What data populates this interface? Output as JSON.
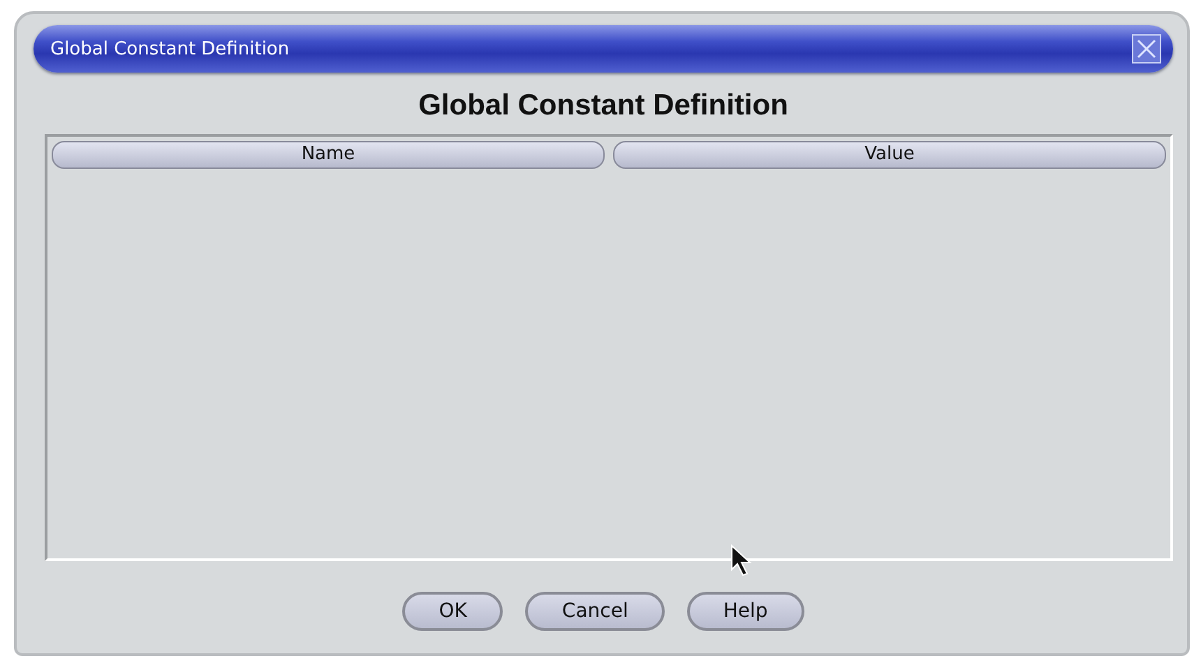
{
  "window": {
    "title": "Global Constant Definition"
  },
  "heading": "Global Constant Definition",
  "table": {
    "columns": [
      "Name",
      "Value"
    ]
  },
  "buttons": [
    "OK",
    "Cancel",
    "Help"
  ]
}
